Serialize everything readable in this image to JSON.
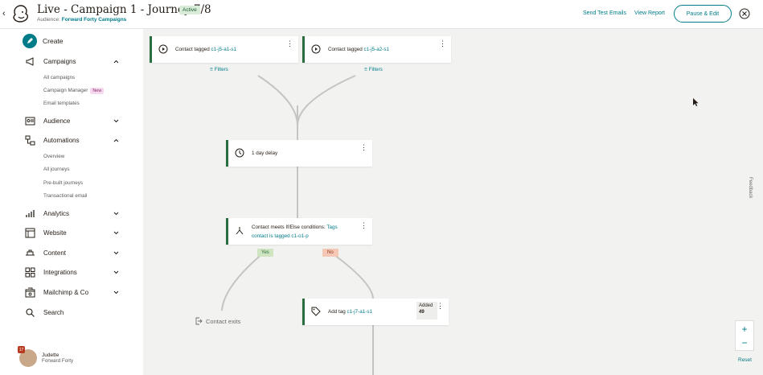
{
  "header": {
    "title": "Live - Campaign 1 - Journey 7/8",
    "status": "Active",
    "audience_prefix": "Audience:",
    "audience_name": "Forward Forty Campaigns",
    "send_test_label": "Send Test Emails",
    "view_report_label": "View Report",
    "pause_edit_label": "Pause & Edit"
  },
  "sidebar": {
    "create_label": "Create",
    "items": [
      {
        "label": "Campaigns",
        "icon": "megaphone-icon",
        "expanded": true
      },
      {
        "label": "Audience",
        "icon": "audience-icon",
        "expanded": false
      },
      {
        "label": "Automations",
        "icon": "automations-icon",
        "expanded": true
      },
      {
        "label": "Analytics",
        "icon": "analytics-icon",
        "expanded": false
      },
      {
        "label": "Website",
        "icon": "website-icon",
        "expanded": false
      },
      {
        "label": "Content",
        "icon": "content-icon",
        "expanded": false
      },
      {
        "label": "Integrations",
        "icon": "integrations-icon",
        "expanded": false
      },
      {
        "label": "Mailchimp & Co",
        "icon": "mailchimp-co-icon",
        "expanded": false
      },
      {
        "label": "Search",
        "icon": "search-icon"
      }
    ],
    "campaigns_sub": [
      "All campaigns",
      "Campaign Manager",
      "Email templates"
    ],
    "new_badge": "New",
    "automations_sub": [
      "Overview",
      "All journeys",
      "Pre-built journeys",
      "Transactional email"
    ],
    "user": {
      "name": "Judette",
      "org": "Forward Forty",
      "badge": "17"
    }
  },
  "canvas": {
    "trigger1": {
      "prefix": "Contact tagged ",
      "tag": "c1-j5-a1-s1"
    },
    "trigger2": {
      "prefix": "Contact tagged ",
      "tag": "c1-j5-a2-s1"
    },
    "filters_label": "Filters",
    "delay": {
      "text": "1 day delay"
    },
    "condition": {
      "prefix": "Contact meets If/Else conditions: ",
      "tag_line1": "Tags",
      "tag_line2": "contact is tagged c1-o1-p"
    },
    "yes_label": "Yes",
    "no_label": "No",
    "add_tag": {
      "prefix": "Add tag ",
      "tag": "c1-j7-a1-s1",
      "added_label": "Added",
      "added_count": "49"
    },
    "exits_label": "Contact exits",
    "feedback_label": "Feedback",
    "zoom_in": "+",
    "zoom_out": "−",
    "reset_label": "Reset"
  },
  "colors": {
    "accent": "#007c89",
    "node_border": "#2a6e3f",
    "canvas_bg": "#f2f2f0"
  }
}
